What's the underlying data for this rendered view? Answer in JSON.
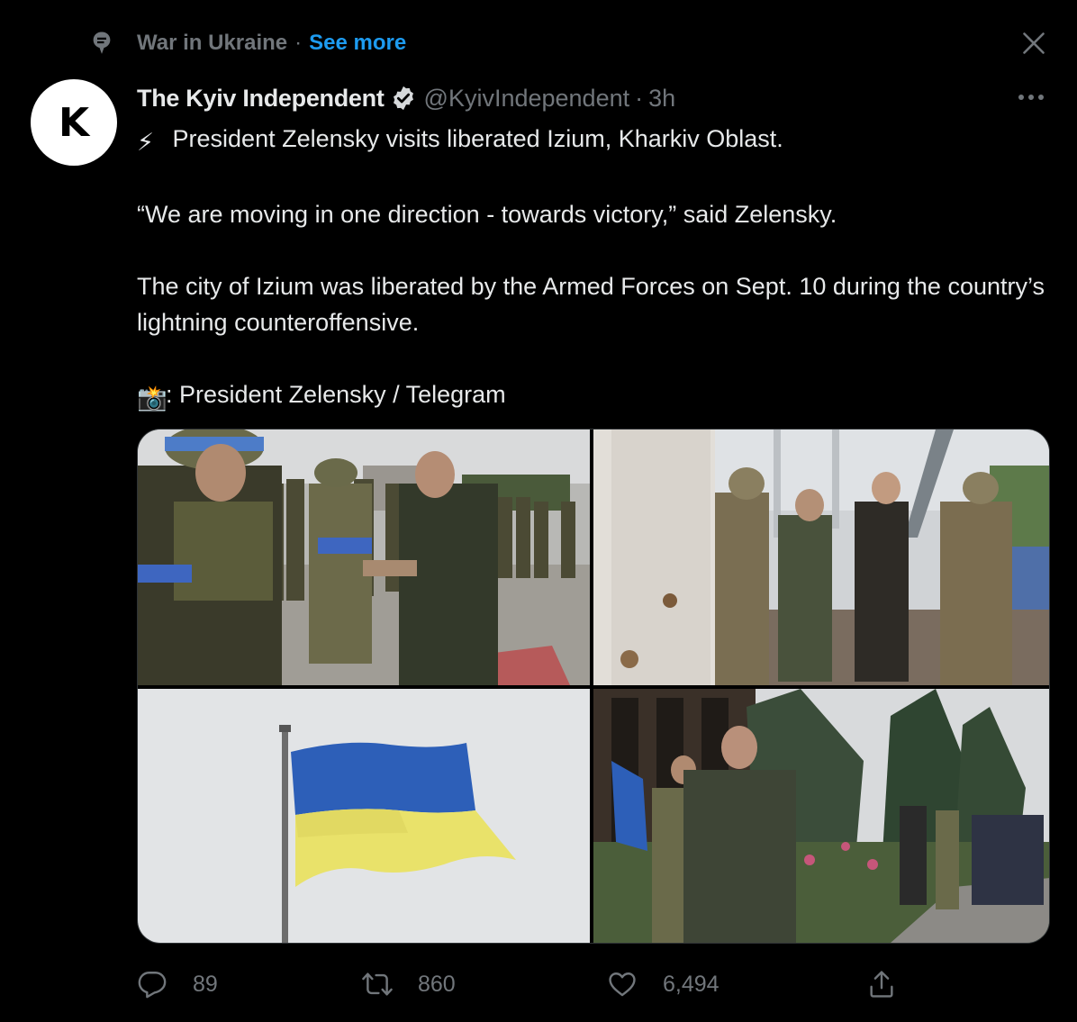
{
  "topic": {
    "name": "War in Ukraine",
    "separator": "·",
    "see_more": "See more"
  },
  "tweet": {
    "avatar_letter": "K",
    "author": "The Kyiv Independent",
    "handle": "@KyivIndependent",
    "separator": "·",
    "time": "3h",
    "lines": {
      "line1": "President Zelensky visits liberated Izium, Kharkiv Oblast.",
      "line2": "“We are moving in one direction - towards victory,” said Zelensky.",
      "line3": "The city of Izium was liberated by the Armed Forces on Sept. 10 during the country’s lightning counteroffensive.",
      "line4": ": President Zelensky / Telegram"
    },
    "emoji": {
      "line1": "⚡",
      "line4": "📸"
    }
  },
  "metrics": {
    "replies": "89",
    "retweets": "860",
    "likes": "6,494"
  },
  "media": {
    "photos": [
      {
        "icon": "soldiers-handshake-photo"
      },
      {
        "icon": "soldiers-walking-bridge-photo"
      },
      {
        "icon": "ukrainian-flag-photo"
      },
      {
        "icon": "zelensky-standing-photo"
      }
    ]
  },
  "colors": {
    "background": "#000000",
    "text": "#e7e9ea",
    "muted": "#71767b",
    "accent": "#1d9bf0",
    "flag_blue": "#2d5fb8",
    "flag_yellow": "#e9e26a"
  }
}
